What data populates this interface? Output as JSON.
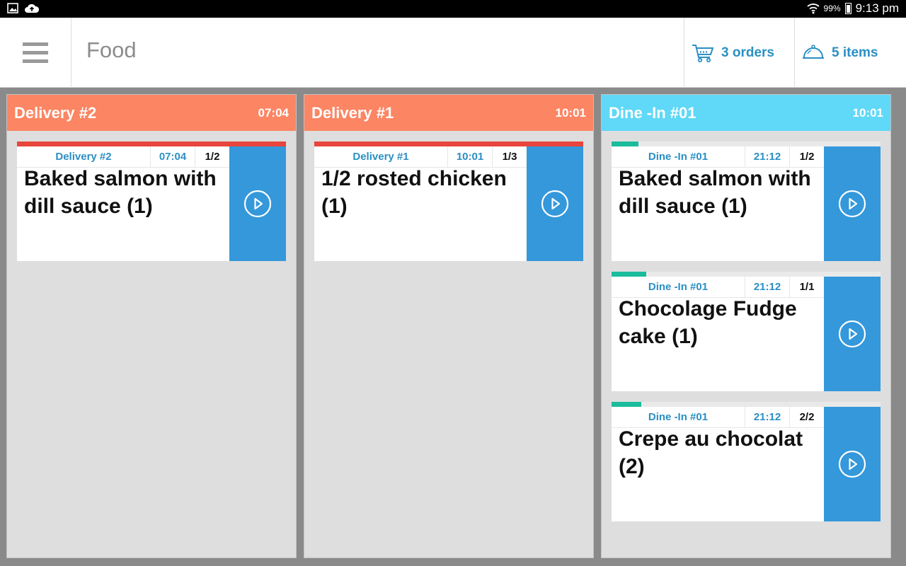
{
  "status_bar": {
    "battery": "99%",
    "clock": "9:13 pm"
  },
  "app_bar": {
    "title": "Food",
    "orders_label": "3 orders",
    "items_label": "5 items"
  },
  "colors": {
    "delivery_header": "#fc8563",
    "dinein_header": "#60d8f7",
    "accent_blue": "#2b8fc4",
    "play_button": "#3498db",
    "progress_red": "#e8453c",
    "progress_green": "#1abc9c"
  },
  "columns": [
    {
      "title": "Delivery #2",
      "time": "07:04",
      "tickets": [
        {
          "order": "Delivery #2",
          "time": "07:04",
          "count": "1/2",
          "dish": "Baked salmon with dill sauce (1)",
          "progress": 1.0
        }
      ]
    },
    {
      "title": "Delivery #1",
      "time": "10:01",
      "tickets": [
        {
          "order": "Delivery #1",
          "time": "10:01",
          "count": "1/3",
          "dish": "1/2 rosted chicken (1)",
          "progress": 1.0
        }
      ]
    },
    {
      "title": "Dine -In #01",
      "time": "10:01",
      "tickets": [
        {
          "order": "Dine -In #01",
          "time": "21:12",
          "count": "1/2",
          "dish": "Baked salmon with dill sauce (1)",
          "progress": 0.1
        },
        {
          "order": "Dine -In #01",
          "time": "21:12",
          "count": "1/1",
          "dish": "Chocolage Fudge cake (1)",
          "progress": 0.13
        },
        {
          "order": "Dine -In #01",
          "time": "21:12",
          "count": "2/2",
          "dish": "Crepe au chocolat (2)",
          "progress": 0.11
        }
      ]
    }
  ]
}
